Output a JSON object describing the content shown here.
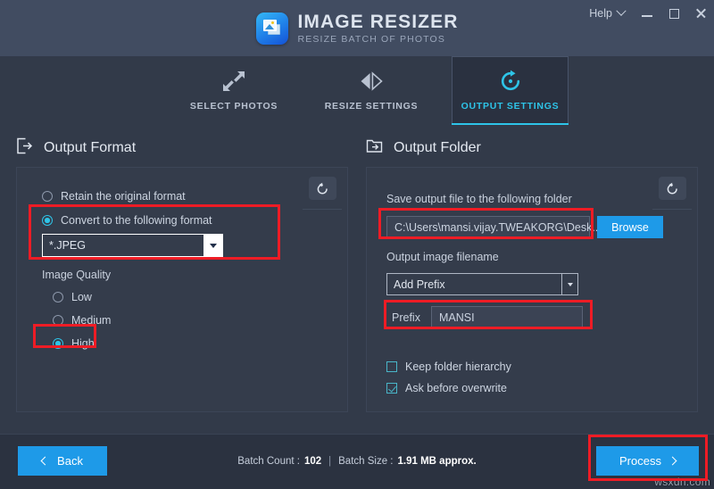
{
  "window": {
    "title": "IMAGE RESIZER",
    "subtitle": "RESIZE BATCH OF PHOTOS",
    "help_label": "Help",
    "minimize_label": "Minimize",
    "maximize_label": "Maximize",
    "close_label": "Close"
  },
  "tabs": [
    {
      "label": "SELECT PHOTOS",
      "icon": "expand-arrows-icon",
      "active": false
    },
    {
      "label": "RESIZE SETTINGS",
      "icon": "mirror-icon",
      "active": false
    },
    {
      "label": "OUTPUT SETTINGS",
      "icon": "refresh-icon",
      "active": true
    }
  ],
  "output_format": {
    "heading": "Output Format",
    "heading_icon": "export-icon",
    "reset_icon": "reset-icon",
    "options": [
      {
        "label": "Retain the original format",
        "selected": false
      },
      {
        "label": "Convert to the following format",
        "selected": true
      }
    ],
    "format_select": {
      "value": "*.JPEG",
      "caret_icon": "chevron-down-icon"
    },
    "quality_label": "Image Quality",
    "quality_options": [
      {
        "label": "Low",
        "selected": false
      },
      {
        "label": "Medium",
        "selected": false
      },
      {
        "label": "High",
        "selected": true
      }
    ]
  },
  "output_folder": {
    "heading": "Output Folder",
    "heading_icon": "folder-export-icon",
    "reset_icon": "reset-icon",
    "save_label": "Save output file to the following folder",
    "path_value": "C:\\Users\\mansi.vijay.TWEAKORG\\Desk...",
    "browse_label": "Browse",
    "filename_label": "Output image filename",
    "prefix_mode": {
      "value": "Add Prefix",
      "caret_icon": "chevron-down-icon"
    },
    "prefix_field_label": "Prefix",
    "prefix_value": "MANSI",
    "checkboxes": [
      {
        "label": "Keep folder hierarchy",
        "checked": false
      },
      {
        "label": "Ask before overwrite",
        "checked": true
      }
    ]
  },
  "footer": {
    "back_label": "Back",
    "process_label": "Process",
    "batch_count_label": "Batch Count :",
    "batch_count_value": "102",
    "separator": "|",
    "batch_size_label": "Batch Size :",
    "batch_size_value": "1.91 MB approx."
  },
  "watermark": "wsxdn.com",
  "colors": {
    "accent_blue": "#1e9ae8",
    "accent_cyan": "#2ec4e8",
    "highlight_red": "#ee1c25",
    "titlebar": "#414c61",
    "panel": "#343c4b",
    "background": "#323a49",
    "footer": "#2b3240"
  }
}
